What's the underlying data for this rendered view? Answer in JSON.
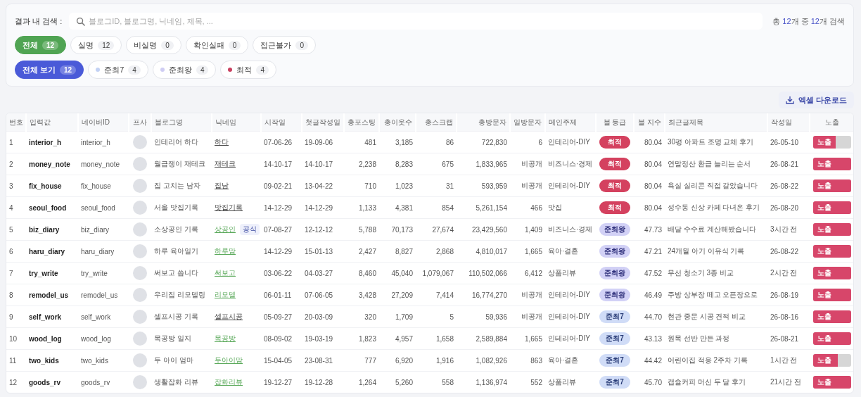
{
  "search": {
    "label": "결과 내 검색 :",
    "placeholder": "블로그ID, 블로그명, 닉네임, 제목, ...",
    "summary": "총 **12**개 중 **12**개 검색"
  },
  "status_filters": [
    {
      "label": "전체",
      "count": "12",
      "selected": true
    },
    {
      "label": "실명",
      "count": "12",
      "selected": false
    },
    {
      "label": "비실명",
      "count": "0",
      "selected": false
    },
    {
      "label": "확인실패",
      "count": "0",
      "selected": false
    },
    {
      "label": "접근불가",
      "count": "0",
      "selected": false
    }
  ],
  "grade_filters": [
    {
      "label": "전체 보기",
      "count": "12",
      "selected": true
    },
    {
      "label": "준최7",
      "count": "4",
      "selected": false,
      "color": "#c3d2f4"
    },
    {
      "label": "준최왕",
      "count": "4",
      "selected": false,
      "color": "#cfcdf3"
    },
    {
      "label": "최적",
      "count": "4",
      "selected": false,
      "color": "#c9405f"
    }
  ],
  "excel_button": "엑셀 다운로드",
  "table": {
    "columns": [
      "번호",
      "입력값",
      "네이버ID",
      "프사",
      "블로그명",
      "닉네임",
      "시작일",
      "첫글작성일",
      "총포스팅",
      "총이웃수",
      "총스크랩",
      "총방문자",
      "일방문자",
      "메인주제",
      "블 등급",
      "블 지수",
      "최근글제목",
      "작성일",
      "노출"
    ],
    "rows": [
      {
        "no": "1",
        "input": "interior_h",
        "naver_id": "interior_h",
        "blog_name": "인테리어 하다",
        "nickname": "하다",
        "nickname_highlighted": false,
        "start": "07-06-26",
        "first_post": "19-09-06",
        "posts": "481",
        "neighbors": "3,185",
        "scraps": "86",
        "visitors": "722,830",
        "daily": "6",
        "topic": "인테리어-DIY",
        "grade": {
          "label": "최적",
          "kind": "optimal"
        },
        "index": "80.04",
        "recent_title": "30평 아파트 조명 교체 후기",
        "date": "26-05-10",
        "exposure": {
          "label": "노출",
          "level": 0.6
        }
      },
      {
        "no": "2",
        "input": "money_note",
        "naver_id": "money_note",
        "blog_name": "월급쟁이 재테크",
        "nickname": "재테크",
        "nickname_highlighted": false,
        "start": "14-10-17",
        "first_post": "14-10-17",
        "posts": "2,238",
        "neighbors": "8,283",
        "scraps": "675",
        "visitors": "1,833,965",
        "daily": "비공개",
        "topic": "비즈니스·경제",
        "grade": {
          "label": "최적",
          "kind": "optimal"
        },
        "index": "80.04",
        "recent_title": "연말정산 환급 늘리는 순서",
        "date": "26-08-21",
        "exposure": {
          "label": "노출",
          "level": 1
        }
      },
      {
        "no": "3",
        "input": "fix_house",
        "naver_id": "fix_house",
        "blog_name": "집 고치는 남자",
        "nickname": "집남",
        "nickname_highlighted": false,
        "start": "09-02-21",
        "first_post": "13-04-22",
        "posts": "710",
        "neighbors": "1,023",
        "scraps": "31",
        "visitors": "593,959",
        "daily": "비공개",
        "topic": "인테리어-DIY",
        "grade": {
          "label": "최적",
          "kind": "optimal"
        },
        "index": "80.04",
        "recent_title": "욕실 실리콘 직접 갈았습니다",
        "date": "26-08-22",
        "exposure": {
          "label": "노출",
          "level": 1
        }
      },
      {
        "no": "4",
        "input": "seoul_food",
        "naver_id": "seoul_food",
        "blog_name": "서울 맛집기록",
        "nickname": "맛집기록",
        "nickname_highlighted": false,
        "start": "14-12-29",
        "first_post": "14-12-29",
        "posts": "1,133",
        "neighbors": "4,381",
        "scraps": "854",
        "visitors": "5,261,154",
        "daily": "466",
        "topic": "맛집",
        "grade": {
          "label": "최적",
          "kind": "optimal"
        },
        "index": "80.04",
        "recent_title": "성수동 신상 카페 다녀온 후기",
        "date": "26-08-20",
        "exposure": {
          "label": "노출",
          "level": 1
        }
      },
      {
        "no": "5",
        "input": "biz_diary",
        "naver_id": "biz_diary",
        "blog_name": "소상공인 기록",
        "nickname": "상공인",
        "nickname_highlighted": true,
        "badge": "공식",
        "start": "07-08-27",
        "first_post": "12-12-12",
        "posts": "5,788",
        "neighbors": "70,173",
        "scraps": "27,674",
        "visitors": "23,429,560",
        "daily": "1,409",
        "topic": "비즈니스·경제",
        "grade": {
          "label": "준최왕",
          "kind": "king"
        },
        "index": "47.73",
        "recent_title": "배달 수수료 계산해봤습니다",
        "date": "3시간 전",
        "exposure": {
          "label": "노출",
          "level": 1
        }
      },
      {
        "no": "6",
        "input": "haru_diary",
        "naver_id": "haru_diary",
        "blog_name": "하루 육아일기",
        "nickname": "하루맘",
        "nickname_highlighted": true,
        "start": "14-12-29",
        "first_post": "15-01-13",
        "posts": "2,427",
        "neighbors": "8,827",
        "scraps": "2,868",
        "visitors": "4,810,017",
        "daily": "1,665",
        "topic": "육아·결혼",
        "grade": {
          "label": "준최왕",
          "kind": "king"
        },
        "index": "47.21",
        "recent_title": "24개월 아기 이유식 기록",
        "date": "26-08-22",
        "exposure": {
          "label": "노출",
          "level": 1
        }
      },
      {
        "no": "7",
        "input": "try_write",
        "naver_id": "try_write",
        "blog_name": "써보고 씁니다",
        "nickname": "써보고",
        "nickname_highlighted": true,
        "start": "03-06-22",
        "first_post": "04-03-27",
        "posts": "8,460",
        "neighbors": "45,040",
        "scraps": "1,079,067",
        "visitors": "110,502,066",
        "daily": "6,412",
        "topic": "상품리뷰",
        "grade": {
          "label": "준최왕",
          "kind": "king"
        },
        "index": "47.52",
        "recent_title": "무선 청소기 3종 비교",
        "date": "2시간 전",
        "exposure": {
          "label": "노출",
          "level": 1
        }
      },
      {
        "no": "8",
        "input": "remodel_us",
        "naver_id": "remodel_us",
        "blog_name": "우리집 리모델링",
        "nickname": "리모델",
        "nickname_highlighted": true,
        "start": "06-01-11",
        "first_post": "07-06-05",
        "posts": "3,428",
        "neighbors": "27,209",
        "scraps": "7,414",
        "visitors": "16,774,270",
        "daily": "비공개",
        "topic": "인테리어-DIY",
        "grade": {
          "label": "준최왕",
          "kind": "king"
        },
        "index": "46.49",
        "recent_title": "주방 상부장 떼고 오픈장으로",
        "date": "26-08-19",
        "exposure": {
          "label": "노출",
          "level": 1
        }
      },
      {
        "no": "9",
        "input": "self_work",
        "naver_id": "self_work",
        "blog_name": "셀프시공 기록",
        "nickname": "셀프시공",
        "nickname_highlighted": false,
        "start": "05-09-27",
        "first_post": "20-03-09",
        "posts": "320",
        "neighbors": "1,709",
        "scraps": "5",
        "visitors": "59,936",
        "daily": "비공개",
        "topic": "인테리어-DIY",
        "grade": {
          "label": "준최7",
          "kind": "semi7"
        },
        "index": "44.70",
        "recent_title": "현관 중문 시공 견적 비교",
        "date": "26-08-16",
        "exposure": {
          "label": "노출",
          "level": 1
        }
      },
      {
        "no": "10",
        "input": "wood_log",
        "naver_id": "wood_log",
        "blog_name": "목공방 일지",
        "nickname": "목공방",
        "nickname_highlighted": true,
        "start": "08-09-02",
        "first_post": "19-03-19",
        "posts": "1,823",
        "neighbors": "4,957",
        "scraps": "1,658",
        "visitors": "2,589,884",
        "daily": "1,665",
        "topic": "인테리어-DIY",
        "grade": {
          "label": "준최7",
          "kind": "semi7"
        },
        "index": "43.13",
        "recent_title": "원목 선반 만든 과정",
        "date": "26-08-21",
        "exposure": {
          "label": "노출",
          "level": 1
        }
      },
      {
        "no": "11",
        "input": "two_kids",
        "naver_id": "two_kids",
        "blog_name": "두 아이 엄마",
        "nickname": "두아이맘",
        "nickname_highlighted": true,
        "start": "15-04-05",
        "first_post": "23-08-31",
        "posts": "777",
        "neighbors": "6,920",
        "scraps": "1,916",
        "visitors": "1,082,926",
        "daily": "863",
        "topic": "육아·결혼",
        "grade": {
          "label": "준최7",
          "kind": "semi7"
        },
        "index": "44.42",
        "recent_title": "어린이집 적응 2주차 기록",
        "date": "1시간 전",
        "exposure": {
          "label": "노출",
          "level": 0.65
        }
      },
      {
        "no": "12",
        "input": "goods_rv",
        "naver_id": "goods_rv",
        "blog_name": "생활잡화 리뷰",
        "nickname": "잡화리뷰",
        "nickname_highlighted": true,
        "start": "19-12-27",
        "first_post": "19-12-28",
        "posts": "1,264",
        "neighbors": "5,260",
        "scraps": "558",
        "visitors": "1,136,974",
        "daily": "552",
        "topic": "상품리뷰",
        "grade": {
          "label": "준최7",
          "kind": "semi7"
        },
        "index": "45.70",
        "recent_title": "캡슐커피 머신 두 달 후기",
        "date": "21시간 전",
        "exposure": {
          "label": "노출",
          "level": 1
        }
      }
    ]
  }
}
